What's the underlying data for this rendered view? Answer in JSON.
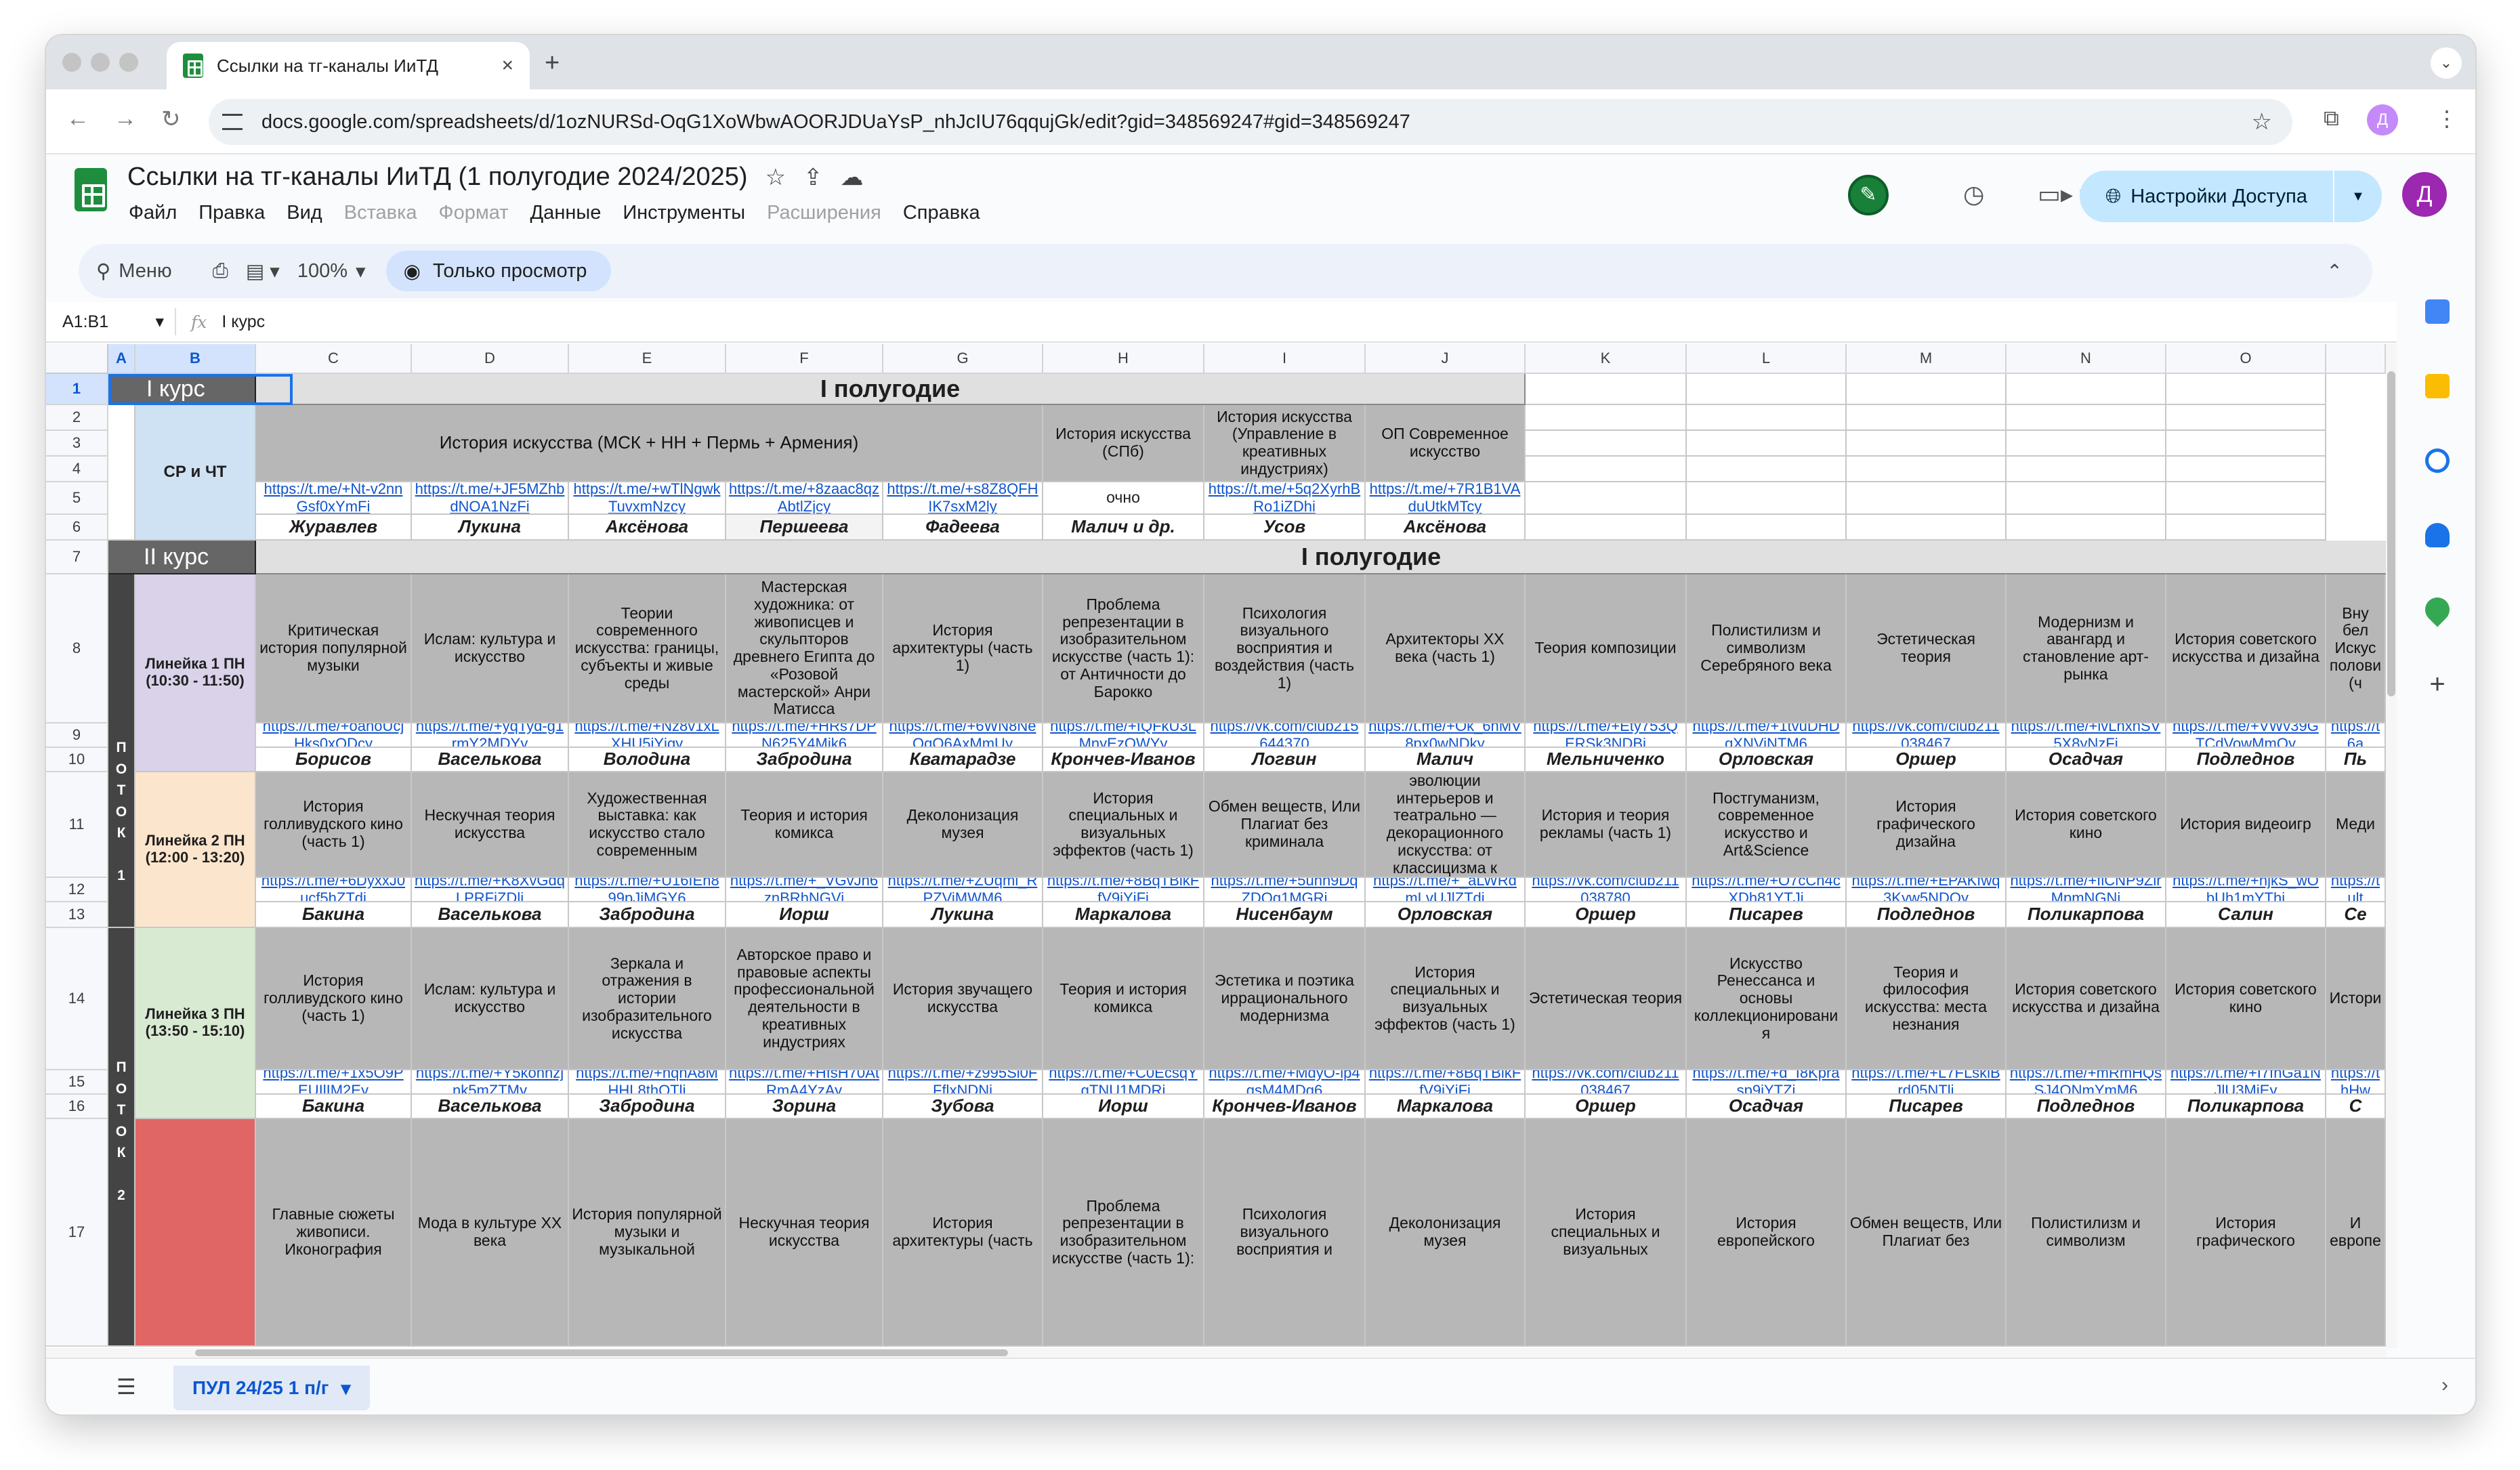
{
  "browser": {
    "tab_title": "Ссылки на тг-каналы ИиТД",
    "tab_close": "×",
    "new_tab": "+",
    "tab_menu": "⌄",
    "url": "docs.google.com/spreadsheets/d/1ozNURSd-OqG1XoWbwAOORJDUaYsP_nhJcIU76qqujGk/edit?gid=348569247#gid=348569247",
    "profile_initial": "Д"
  },
  "doc": {
    "title": "Ссылки на тг-каналы ИиТД (1 полугодие 2024/2025)",
    "menus": [
      "Файл",
      "Правка",
      "Вид",
      "Вставка",
      "Формат",
      "Данные",
      "Инструменты",
      "Расширения",
      "Справка"
    ],
    "share_label": "Настройки Доступа",
    "avatar_initial": "Д"
  },
  "toolbar": {
    "menu_label": "Меню",
    "zoom": "100%",
    "view_only": "Только просмотр"
  },
  "formula_bar": {
    "name_box": "A1:B1",
    "fx": "fx",
    "value": "I курс"
  },
  "grid": {
    "columns": [
      "A",
      "B",
      "C",
      "D",
      "E",
      "F",
      "G",
      "H",
      "I",
      "J",
      "K",
      "L",
      "M",
      "N",
      "O"
    ],
    "rows": [
      "1",
      "2",
      "3",
      "4",
      "5",
      "6",
      "7",
      "8",
      "9",
      "10",
      "11",
      "12",
      "13",
      "14",
      "15",
      "16",
      "17"
    ],
    "kurs1": "I курс",
    "kurs2": "II курс",
    "polugodie": "I полугодие",
    "sr_cht": "СР и ЧТ",
    "potok1": "П\nО\nТ\nО\nК\n\n1",
    "potok2": "П\nО\nТ\nО\nК\n\n2",
    "first_course": {
      "subjects": [
        "История искусства (МСК + НН + Пермь + Армения)",
        "История искусства (СПб)",
        "История искусства (Управление в креативных индустриях)",
        "ОП Современное искусство"
      ],
      "links": [
        "https://t.me/+Nt-v2nnGsf0xYmFi",
        "https://t.me/+JF5MZhbdNOA1NzFi",
        "https://t.me/+wTlNgwkTuvxmNzcy",
        "https://t.me/+8zaac8qzAbtlZjcy",
        "https://t.me/+s8Z8QFHIK7sxM2ly",
        "очно",
        "https://t.me/+5q2XyrhBRo1iZDhi",
        "https://t.me/+7R1B1VAduUtkMTcy"
      ],
      "teachers": [
        "Журавлев",
        "Лукина",
        "Аксёнова",
        "Першеева",
        "Фадеева",
        "Малич и др.",
        "Усов",
        "Аксёнова"
      ]
    },
    "line1": {
      "label": "Линейка 1 ПН (10:30 - 11:50)",
      "subjects": [
        "Критическая история популярной музыки",
        "Ислам: культура и искусство",
        "Теории современного искусства: границы, субъекты и живые среды",
        "Мастерская художника: от живописцев и скульпторов древнего Египта до «Розовой мастерской» Анри Матисса",
        "История архитектуры (часть 1)",
        "Проблема репрезентации в изобразительном искусстве (часть 1): от Античности до Барокко",
        "Психология визуального восприятия и воздействия (часть 1)",
        "Архитекторы XX века (часть 1)",
        "Теория композиции",
        "Полистилизм и символизм Серебряного века",
        "Эстетическая теория",
        "Модернизм и авангард и становление арт-рынка",
        "История советского искусства и дизайна",
        "Вну бел Искус полови (ч"
      ],
      "links": [
        "https://t.me/+oanoUcjHks0xODcy",
        "https://t.me/+yqTyd-g1rmY2MDYy",
        "https://t.me/+Nz8v1xLXHU5iYjgy",
        "https://t.me/+HRs7DPN625Y4Mjk6",
        "https://t.me/+6WN8NeQqO6AxMmUy",
        "https://t.me/+fQFkU3LMnyEzOWYy",
        "https://vk.com/club215644370",
        "https://t.me/+Ok_6hMV8px0wNDky",
        "https://t.me/+Ety753QERSk3NDBi",
        "https://t.me/+1tvuDHDqXNViNTM6",
        "https://vk.com/club211038467",
        "https://t.me/+lvLhxnSV5X8yNzFi",
        "https://t.me/+VWv39GTCdVowMmQy",
        "https://t 6a"
      ],
      "teachers": [
        "Борисов",
        "Васелькова",
        "Володина",
        "Забродина",
        "Кватарадзе",
        "Крончев-Иванов",
        "Логвин",
        "Малич",
        "Мельниченко",
        "Орловская",
        "Оршер",
        "Осадчая",
        "Подледнов",
        "Пь"
      ]
    },
    "line2": {
      "label": "Линейка 2 ПН (12:00 - 13:20)",
      "subjects": [
        "История голливудского кино (часть 1)",
        "Нескучная теория искусства",
        "Художественная выставка: как искусство стало современным",
        "Теория и история комикса",
        "Деколонизация музея",
        "История специальных и визуальных эффектов (часть 1)",
        "Обмен веществ, Или Плагиат без криминала",
        "Два столетия эволюции интерьеров и театрально — декорационного искусства: от классицизма к модернизму",
        "История и теория рекламы (часть 1)",
        "Постгуманизм, современное искусство и Art&Science",
        "История графического дизайна",
        "История советского кино",
        "История видеоигр",
        "Меди"
      ],
      "links": [
        "https://t.me/+6DyxxJ0ucf5hZTdi",
        "https://t.me/+K8XvGdqLPRFiZDli",
        "https://t.me/+U16IEh899pJiMGY6",
        "https://t.me/+_VGvJn6znBRhNGVi",
        "https://t.me/+ZUqmi_RPZViMWM6",
        "https://t.me/+8BqTBikFfV9jYjFi",
        "https://t.me/+5uhn9DqZDOg1MGRi",
        "https://t.me/+_aLWRdmLvUJlZTdi",
        "https://vk.com/club211038780",
        "https://t.me/+O7cCn4cXDh81YTJi",
        "https://t.me/+EPAKfwq3Kyw5NDQy",
        "https://t.me/+flCNP9ZirMpmNGNi",
        "https://t.me/+njkS_wObUh1mYThi",
        "https://t ult"
      ],
      "teachers": [
        "Бакина",
        "Васелькова",
        "Забродина",
        "Иорш",
        "Лукина",
        "Маркалова",
        "Нисенбаум",
        "Орловская",
        "Оршер",
        "Писарев",
        "Подледнов",
        "Поликарпова",
        "Салин",
        "Се"
      ]
    },
    "line3": {
      "label": "Линейка 3 ПН (13:50 - 15:10)",
      "subjects": [
        "История голливудского кино (часть 1)",
        "Ислам: культура и искусство",
        "Зеркала и отражения в истории изобразительного искусства",
        "Авторское право и правовые аспекты профессиональной деятельности в креативных индустриях",
        "История звучащего искусства",
        "Теория и история комикса",
        "Эстетика и поэтика иррационального модернизма",
        "История специальных и визуальных эффектов (часть 1)",
        "Эстетическая теория",
        "Искусство Ренессанса и основы коллекционировани я",
        "Теория и философия искусства: места незнания",
        "История советского искусства и дизайна",
        "История советского кино",
        "Истори"
      ],
      "links": [
        "https://t.me/+1x5O9PEUIlIM2Ey",
        "https://t.me/+Y5kohnzjnk5mZTMy",
        "https://t.me/+nqnA8MHHL8thOTli",
        "https://t.me/+HfsH70AtRmA4YzAy",
        "https://t.me/+z995Sl0FFflxNDNi",
        "https://t.me/+C0EcsqYgTNU1MDRi",
        "https://t.me/+MdyO-lp4gsM4MDg6",
        "https://t.me/+8BqTBikFfV9jYjFi",
        "https://vk.com/club211038467",
        "https://t.me/+d_I8Kprasp9iYTZi",
        "https://t.me/+L7FLsklBrd05NTli",
        "https://t.me/+mRmHQsSJ4ONmYmM6",
        "https://t.me/+I7fnGa1NJlU3MjEy",
        "https://t hHw"
      ],
      "teachers": [
        "Бакина",
        "Васелькова",
        "Забродина",
        "Зорина",
        "Зубова",
        "Иорш",
        "Крончев-Иванов",
        "Маркалова",
        "Оршер",
        "Осадчая",
        "Писарев",
        "Подледнов",
        "Поликарпова",
        "С"
      ]
    },
    "line4": {
      "subjects": [
        "Главные сюжеты живописи. Иконография",
        "Мода в культуре XX века",
        "История популярной музыки и музыкальной",
        "Нескучная теория искусства",
        "История архитектуры (часть",
        "Проблема репрезентации в изобразительном искусстве (часть 1):",
        "Психология визуального восприятия и",
        "Деколонизация музея",
        "История специальных и визуальных",
        "История европейского",
        "Обмен веществ, Или Плагиат без",
        "Полистилизм и символизм",
        "История графического",
        "И европе"
      ]
    }
  },
  "sheet_tab": "ПУЛ 24/25 1 п/г",
  "colors": {
    "sr_cht_bg": "#cfe2f3",
    "line1_bg": "#d9d2e9",
    "line2_bg": "#fce5cd",
    "line3_bg": "#d9ead3",
    "line4_bg": "#e06666",
    "subject_bg": "#b7b7b7",
    "link": "#1155cc"
  }
}
